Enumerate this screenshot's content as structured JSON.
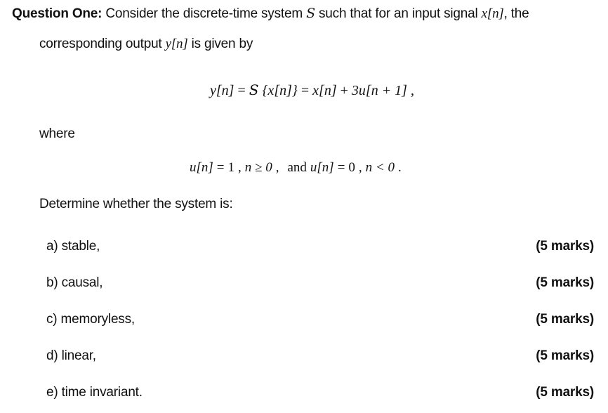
{
  "question": {
    "heading": "Question One:",
    "intro_part1": " Consider the discrete-time system ",
    "system_symbol": "S",
    "intro_part2": " such that for an input signal ",
    "input_signal": "x[n]",
    "intro_part3": ", the",
    "line2_part1": "corresponding output ",
    "output_signal": "y[n]",
    "line2_part2": " is given by"
  },
  "equation_main": {
    "lhs": "y[n]",
    "eq1": "=",
    "sys": "S",
    "arg": "{x[n]}",
    "eq2": "=",
    "term1": "x[n]",
    "plus": "+",
    "term2": "3u[n + 1]",
    "end": ","
  },
  "where_label": "where",
  "equation_step": {
    "part1_lhs": "u[n]",
    "part1_eq": "=",
    "part1_val": "1",
    "comma1": ",",
    "part1_cond": "n ≥ 0",
    "comma2": ",",
    "and": "and",
    "part2_lhs": "u[n]",
    "part2_eq": "=",
    "part2_val": "0",
    "comma3": ",",
    "part2_cond": "n < 0",
    "end": "."
  },
  "prompt": "Determine whether the system is:",
  "items": [
    {
      "label": "a) stable,",
      "marks": "(5 marks)"
    },
    {
      "label": "b) causal,",
      "marks": "(5 marks)"
    },
    {
      "label": "c) memoryless,",
      "marks": "(5 marks)"
    },
    {
      "label": "d) linear,",
      "marks": "(5 marks)"
    },
    {
      "label": "e) time invariant.",
      "marks": "(5 marks)"
    }
  ]
}
